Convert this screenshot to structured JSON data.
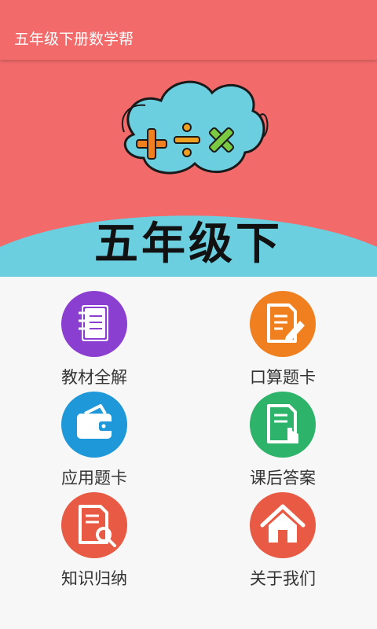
{
  "app": {
    "title": "五年级下册数学帮"
  },
  "banner": {
    "text": "五年级下"
  },
  "menu": [
    {
      "label": "教材全解",
      "color": "#8b3fd0",
      "icon": "notebook-icon"
    },
    {
      "label": "口算题卡",
      "color": "#f07f20",
      "icon": "document-pen-icon"
    },
    {
      "label": "应用题卡",
      "color": "#1e98d9",
      "icon": "wallet-icon"
    },
    {
      "label": "课后答案",
      "color": "#2db36a",
      "icon": "document-touch-icon"
    },
    {
      "label": "知识归纳",
      "color": "#e85a44",
      "icon": "document-search-icon"
    },
    {
      "label": "关于我们",
      "color": "#e85a44",
      "icon": "home-icon"
    }
  ],
  "colors": {
    "primary": "#f26a6a",
    "cloud": "#6ccfe0",
    "banner_arc": "#6ccfe0"
  }
}
